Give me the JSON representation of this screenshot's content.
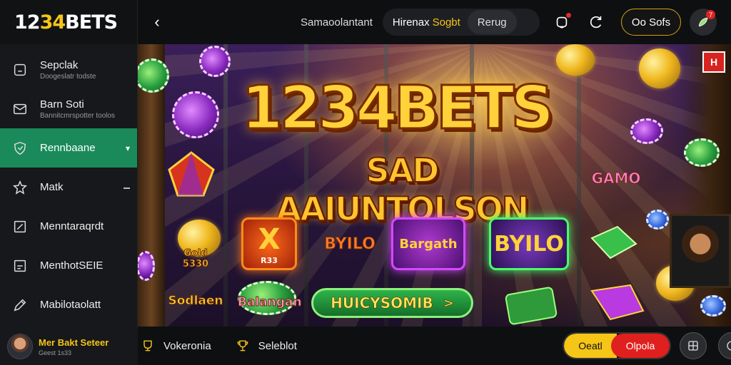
{
  "brand": {
    "logo_prefix": "12",
    "logo_highlight": "34",
    "logo_suffix": "BETS"
  },
  "sidebar": {
    "items": [
      {
        "label": "Sepclak",
        "sub": "Doogeslatr todste",
        "icon": "wallet-icon"
      },
      {
        "label": "Barn Soti",
        "sub": "Bannitcmrspotter toolos",
        "icon": "mail-icon"
      },
      {
        "label": "Rennbaane",
        "sub": "",
        "icon": "shield-icon",
        "active": true
      },
      {
        "label": "Matk",
        "sub": "",
        "icon": "star-icon"
      },
      {
        "label": "Menntaraqrdt",
        "sub": "",
        "icon": "edit-icon"
      },
      {
        "label": "MenthotSEIE",
        "sub": "",
        "icon": "note-icon"
      },
      {
        "label": "Mabilotaolatt",
        "sub": "",
        "icon": "pen-icon"
      }
    ],
    "user": {
      "name": "Mer Bakt Seteer",
      "sub": "Geest 1s33"
    }
  },
  "topbar": {
    "menu_label": "Samaoolantant",
    "search_text": "Hirenax",
    "search_highlight": "Sogbt",
    "search_pill": "Rerug",
    "odds_button": "Oo Sofs",
    "badge_count": "7"
  },
  "banner": {
    "title": "1234BETS",
    "subtitle": "SAD AAIUNTOLSON",
    "cta_label": "HUICYSOMIB",
    "cta_arrow": ">",
    "corner_badge": "H",
    "slots": {
      "slot_x": "X",
      "slot_x_sub": "R33",
      "slot_bllo": "BYILO",
      "slot_bargath": "Bargath"
    },
    "labels": {
      "coin_label_1": "Gold 5330",
      "coin_label_2": "BYILO",
      "coin_label_3": "Sodlaen",
      "coin_label_4": "Balangan",
      "coin_label_5": "GAMO"
    }
  },
  "bottombar": {
    "item1": "Vokeronia",
    "item2": "Seleblot",
    "toggle_a": "Oeatl",
    "toggle_b": "Olpola"
  },
  "colors": {
    "accent": "#f5c518",
    "active_nav": "#1a8a5a",
    "danger": "#e0201e",
    "cta": "#2fb34a"
  }
}
